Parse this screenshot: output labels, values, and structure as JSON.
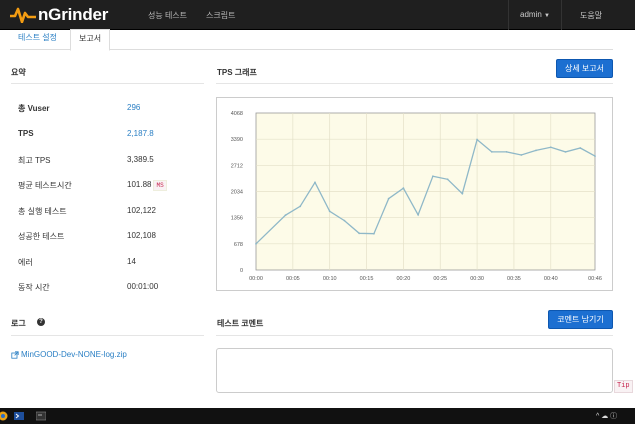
{
  "navbar": {
    "logo_text": "nGrinder",
    "menu": [
      {
        "label": "성능 테스트"
      },
      {
        "label": "스크립트"
      }
    ],
    "user_label": "admin",
    "help_label": "도움말"
  },
  "tabs": [
    {
      "label": "테스트 설정"
    },
    {
      "label": "보고서"
    }
  ],
  "summary": {
    "title": "요약",
    "rows": [
      {
        "label": "총 Vuser",
        "value": "296"
      },
      {
        "label": "TPS",
        "value": "2,187.8"
      },
      {
        "label": "최고 TPS",
        "value": "3,389.5"
      },
      {
        "label": "평균 테스트시간",
        "value": "101.88",
        "unit": "MS"
      },
      {
        "label": "총 실행 테스트",
        "value": "102,122"
      },
      {
        "label": "성공한 테스트",
        "value": "102,108"
      },
      {
        "label": "에러",
        "value": "14"
      },
      {
        "label": "동작 시간",
        "value": "00:01:00"
      }
    ]
  },
  "log": {
    "title": "로그",
    "file_link": "MinGOOD-Dev-NONE-log.zip"
  },
  "tps_panel": {
    "title": "TPS 그래프",
    "detail_button": "상세 보고서"
  },
  "comment_panel": {
    "title": "테스트 코멘트",
    "submit_button": "코멘트 남기기",
    "tip_label": "Tip"
  },
  "chart_data": {
    "type": "line",
    "y_ticks": [
      "0",
      "678",
      "1356",
      "2034",
      "2712",
      "3390",
      "4068"
    ],
    "x_ticks": [
      "00:00",
      "00:05",
      "00:10",
      "00:15",
      "00:20",
      "00:25",
      "00:30",
      "00:35",
      "00:40",
      "00:46"
    ],
    "ylim": [
      0,
      4068
    ],
    "series": [
      {
        "x": [
          0,
          4,
          6,
          8,
          10,
          12,
          14,
          16,
          18,
          20,
          22,
          24,
          26,
          28,
          30,
          32,
          34,
          36,
          38,
          40,
          42,
          44,
          46
        ],
        "values": [
          678,
          1420,
          1650,
          2270,
          1520,
          1280,
          950,
          940,
          1850,
          2120,
          1430,
          2430,
          2350,
          1980,
          3380,
          3060,
          3060,
          2980,
          3100,
          3180,
          3060,
          3160,
          2950
        ]
      }
    ]
  },
  "taskbar": {
    "right_text": "^ ☁ ⓘ"
  },
  "colors": {
    "brand_orange": "#f39c12",
    "line": "#8fb8c8",
    "plot_bg": "#fdfbe8",
    "primary": "#1c6fd1"
  }
}
